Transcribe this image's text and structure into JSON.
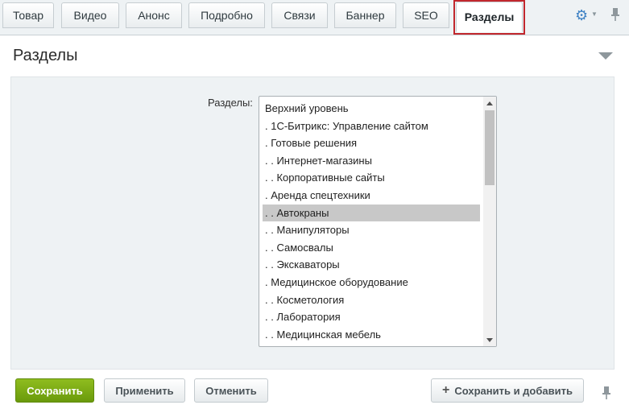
{
  "tabs": [
    {
      "label": "Товар"
    },
    {
      "label": "Видео"
    },
    {
      "label": "Анонс"
    },
    {
      "label": "Подробно"
    },
    {
      "label": "Связи"
    },
    {
      "label": "Баннер"
    },
    {
      "label": "SEO"
    },
    {
      "label": "Разделы",
      "active": true
    }
  ],
  "toolbar": {
    "settings_icon": "gear-icon",
    "pin_icon": "pin-icon"
  },
  "section": {
    "title": "Разделы",
    "collapse_icon": "collapse-arrow-icon"
  },
  "field": {
    "label": "Разделы:",
    "options": [
      "Верхний уровень",
      ". 1С-Битрикс: Управление сайтом",
      ". Готовые решения",
      ". . Интернет-магазины",
      ". . Корпоративные сайты",
      ". Аренда спецтехники",
      ". . Автокраны",
      ". . Манипуляторы",
      ". . Самосвалы",
      ". . Экскаваторы",
      ". Медицинское оборудование",
      ". . Косметология",
      ". . Лаборатория",
      ". . Медицинская мебель"
    ],
    "selected": ". . Автокраны"
  },
  "buttons": {
    "save": "Сохранить",
    "apply": "Применить",
    "cancel": "Отменить",
    "save_and_add": "Сохранить и добавить"
  },
  "colors": {
    "accent_green": "#6a9a0b",
    "highlight_red": "#c1272d",
    "gear_blue": "#3f82c4"
  }
}
